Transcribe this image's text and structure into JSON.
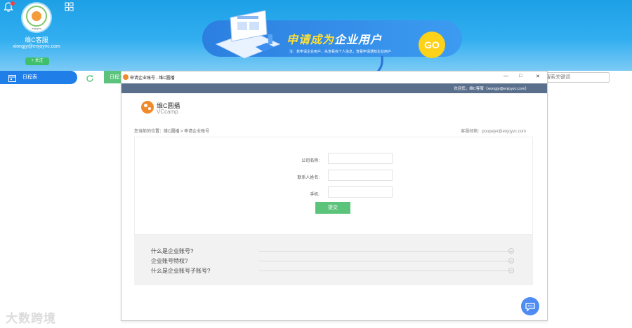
{
  "profile": {
    "avatar_text": "enjoyvc",
    "name": "维C客服",
    "email": "xiongjy@enjoyvc.com",
    "follow_label": "+ 关注"
  },
  "promo": {
    "title_part1": "申请成为",
    "title_part2": "企业用户",
    "subtitle": "注：若申请企业用户，先查看完个人信息，查看申请通知企业用户",
    "go_label": "GO"
  },
  "nav": {
    "schedule_label": "日程表",
    "green_tab_label": "日程卫"
  },
  "search": {
    "placeholder": "搜索关键词"
  },
  "window": {
    "title": "申请企业账号 - 维C圆播",
    "controls": [
      "—",
      "□",
      "✕"
    ],
    "welcome": "欢迎您，维C客服（xiongjy@enjoyvc.com）",
    "logo_cn": "维C圆播",
    "logo_en": "VCcamp",
    "breadcrumb": "您当前的位置：维C圆播 > 申请企业账号",
    "support": "客服邮箱：poopejer@enjoyvc.com",
    "form": {
      "company_label": "公司名称:",
      "contact_label": "联系人姓名:",
      "phone_label": "手机:",
      "company_value": "",
      "contact_value": "",
      "phone_value": "",
      "submit_label": "提交"
    },
    "faq": [
      {
        "label": "什么是企业账号?"
      },
      {
        "label": "企业账号特权?"
      },
      {
        "label": "什么是企业账号子账号?"
      }
    ]
  },
  "watermark": "大数跨境",
  "colors": {
    "banner_blue": "#1ea0e6",
    "nav_blue": "#1f7ee8",
    "green": "#5cc37b",
    "header_slate": "#5a6f8c",
    "chat_blue": "#4e8cf3"
  }
}
